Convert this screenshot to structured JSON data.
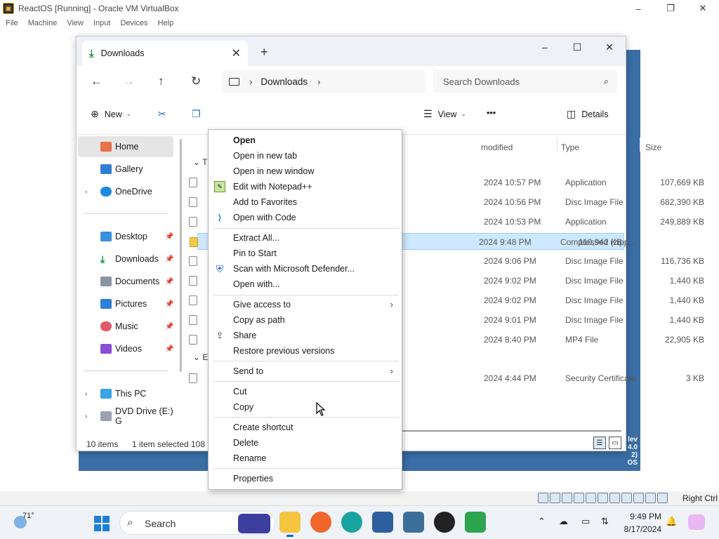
{
  "host_window": {
    "title": "ReactOS [Running] - Oracle VM VirtualBox",
    "controls": [
      "–",
      "❐",
      "✕"
    ],
    "menu": [
      "File",
      "Machine",
      "View",
      "Input",
      "Devices",
      "Help"
    ],
    "host_key": "Right Ctrl"
  },
  "guest_badge": [
    "lev",
    "4.0",
    "2)",
    "OS"
  ],
  "explorer": {
    "tab_title": "Downloads",
    "new_tab": "+",
    "window_controls": [
      "–",
      "☐",
      "✕"
    ],
    "nav": {
      "back": "←",
      "forward": "→",
      "up": "↑",
      "refresh": "↻"
    },
    "breadcrumb": [
      "Downloads"
    ],
    "search_placeholder": "Search Downloads",
    "commands": {
      "new_label": "New",
      "view_label": "View",
      "more_label": "•••",
      "details_label": "Details"
    },
    "sidebar": {
      "home": "Home",
      "gallery": "Gallery",
      "onedrive": "OneDrive",
      "pinned": [
        "Desktop",
        "Downloads",
        "Documents",
        "Pictures",
        "Music",
        "Videos"
      ],
      "this_pc": "This PC",
      "dvd": "DVD Drive (E:) G"
    },
    "columns": {
      "modified": "modified",
      "type": "Type",
      "size": "Size"
    },
    "group_labels": [
      "T",
      "E"
    ],
    "rows": [
      {
        "date": "2024 10:57 PM",
        "type": "Application",
        "size": "107,669 KB"
      },
      {
        "date": "2024 10:56 PM",
        "type": "Disc Image File",
        "size": "682,390 KB"
      },
      {
        "date": "2024 10:53 PM",
        "type": "Application",
        "size": "249,889 KB"
      },
      {
        "date": "2024 9:48 PM",
        "type": "Compressed (zipp...",
        "size": "110,942 KB"
      },
      {
        "date": "2024 9:06 PM",
        "type": "Disc Image File",
        "size": "116,736 KB"
      },
      {
        "date": "2024 9:02 PM",
        "type": "Disc Image File",
        "size": "1,440 KB"
      },
      {
        "date": "2024 9:02 PM",
        "type": "Disc Image File",
        "size": "1,440 KB"
      },
      {
        "date": "2024 9:01 PM",
        "type": "Disc Image File",
        "size": "1,440 KB"
      },
      {
        "date": "2024 8:40 PM",
        "type": "MP4 File",
        "size": "22,905 KB"
      },
      {
        "date": "2024 4:44 PM",
        "type": "Security Certificate",
        "size": "3 KB"
      }
    ],
    "status": {
      "items": "10 items",
      "selected": "1 item selected",
      "selected_size": "108"
    }
  },
  "context_menu": {
    "open": "Open",
    "open_new_tab": "Open in new tab",
    "open_new_window": "Open in new window",
    "edit_notepad": "Edit with Notepad++",
    "add_favorites": "Add to Favorites",
    "open_code": "Open with Code",
    "extract_all": "Extract All...",
    "pin_start": "Pin to Start",
    "scan_defender": "Scan with Microsoft Defender...",
    "open_with": "Open with...",
    "give_access": "Give access to",
    "copy_path": "Copy as path",
    "share": "Share",
    "restore_versions": "Restore previous versions",
    "send_to": "Send to",
    "cut": "Cut",
    "copy": "Copy",
    "create_shortcut": "Create shortcut",
    "delete": "Delete",
    "rename": "Rename",
    "properties": "Properties"
  },
  "taskbar": {
    "temperature": "71°",
    "search_label": "Search",
    "time": "9:49 PM",
    "date": "8/17/2024"
  }
}
